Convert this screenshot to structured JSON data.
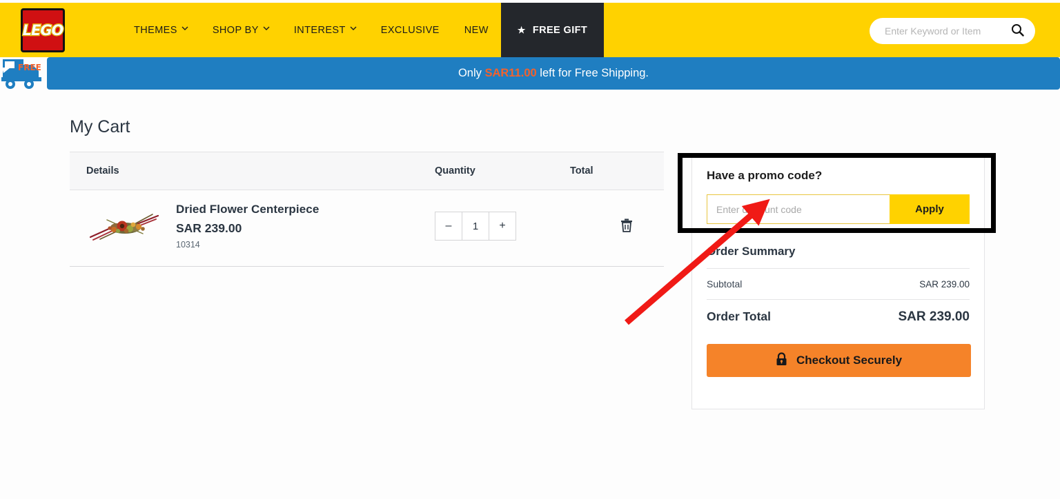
{
  "header": {
    "logo_text": "LEGO",
    "nav": [
      {
        "label": "THEMES",
        "has_caret": true,
        "star": false,
        "dark": false
      },
      {
        "label": "SHOP BY",
        "has_caret": true,
        "star": false,
        "dark": false
      },
      {
        "label": "INTEREST",
        "has_caret": true,
        "star": false,
        "dark": false
      },
      {
        "label": "EXCLUSIVE",
        "has_caret": false,
        "star": false,
        "dark": false
      },
      {
        "label": "NEW",
        "has_caret": false,
        "star": false,
        "dark": false
      },
      {
        "label": "FREE GIFT",
        "has_caret": false,
        "star": true,
        "dark": true
      }
    ],
    "search": {
      "placeholder": "Enter Keyword or Item",
      "value": "",
      "icon": "search-icon"
    },
    "colors": {
      "brand_yellow": "#ffd200",
      "dark_nav": "#24272c"
    }
  },
  "shipping_banner": {
    "prefix": "Only ",
    "amount": "SAR11.00",
    "suffix": " left for Free Shipping.",
    "truck_icon": "free-shipping-truck-icon",
    "truck_badge": "FREE",
    "color": "#1f7ec1",
    "amount_color": "#f4622c"
  },
  "cart": {
    "title": "My Cart",
    "columns": {
      "details": "Details",
      "quantity": "Quantity",
      "total": "Total"
    },
    "items": [
      {
        "name": "Dried Flower Centerpiece",
        "price": "SAR 239.00",
        "sku": "10314",
        "quantity": "1",
        "decrement_label": "–",
        "increment_label": "+",
        "remove_icon": "trash-icon",
        "thumbnail": "dried-flower-centerpiece-image"
      }
    ]
  },
  "promo": {
    "title": "Have a promo code?",
    "input_placeholder": "Enter discount code",
    "input_value": "",
    "apply_label": "Apply"
  },
  "summary": {
    "title": "Order Summary",
    "rows": [
      {
        "label": "Subtotal",
        "value": "SAR 239.00"
      }
    ],
    "total_label": "Order Total",
    "total_value": "SAR 239.00",
    "checkout_label": "Checkout Securely",
    "checkout_icon": "lock-icon",
    "checkout_color": "#f58329"
  },
  "annotations": {
    "highlight_color": "#000000",
    "arrow_color": "#f01a16",
    "arrow_from": "908,468",
    "arrow_to": "1103,298"
  }
}
